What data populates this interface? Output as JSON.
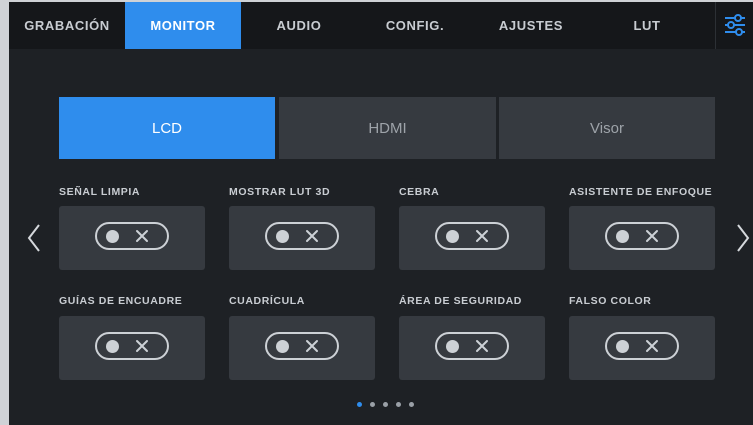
{
  "tabs": [
    {
      "label": "GRABACIÓN",
      "active": false
    },
    {
      "label": "MONITOR",
      "active": true
    },
    {
      "label": "AUDIO",
      "active": false
    },
    {
      "label": "CONFIG.",
      "active": false
    },
    {
      "label": "AJUSTES",
      "active": false
    },
    {
      "label": "LUT",
      "active": false
    }
  ],
  "settings_icon": "sliders-icon",
  "outputs": {
    "items": [
      "LCD",
      "HDMI",
      "Visor"
    ],
    "selected": "LCD"
  },
  "options": [
    {
      "label": "SEÑAL LIMPIA",
      "enabled": false
    },
    {
      "label": "MOSTRAR LUT 3D",
      "enabled": false
    },
    {
      "label": "CEBRA",
      "enabled": false
    },
    {
      "label": "ASISTENTE DE ENFOQUE",
      "enabled": false
    },
    {
      "label": "GUÍAS DE ENCUADRE",
      "enabled": false
    },
    {
      "label": "CUADRÍCULA",
      "enabled": false
    },
    {
      "label": "ÁREA DE SEGURIDAD",
      "enabled": false
    },
    {
      "label": "FALSO COLOR",
      "enabled": false
    }
  ],
  "pagination": {
    "page": 1,
    "total": 5
  },
  "colors": {
    "accent": "#2f8ded",
    "background": "#1e2125",
    "panel": "#363a40",
    "text": "#c9cdd2"
  }
}
